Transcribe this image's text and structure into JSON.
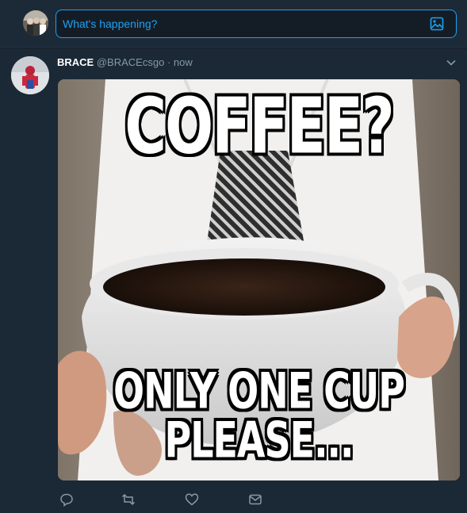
{
  "compose": {
    "placeholder": "What's happening?",
    "avatar_icon": "user-avatar",
    "media_icon": "image-icon"
  },
  "tweet": {
    "display_name": "BRACE",
    "handle": "@BRACEcsgo",
    "separator": "·",
    "time": "now",
    "caret_icon": "chevron-down-icon",
    "media": {
      "top_text": "COFFEE?",
      "bottom_line1": "ONLY ONE CUP",
      "bottom_line2": "PLEASE..."
    },
    "actions": [
      {
        "icon": "reply-icon"
      },
      {
        "icon": "retweet-icon"
      },
      {
        "icon": "like-icon"
      },
      {
        "icon": "message-icon"
      }
    ]
  },
  "colors": {
    "background": "#141d26",
    "accent": "#1da1f2",
    "muted": "#8899a6"
  }
}
